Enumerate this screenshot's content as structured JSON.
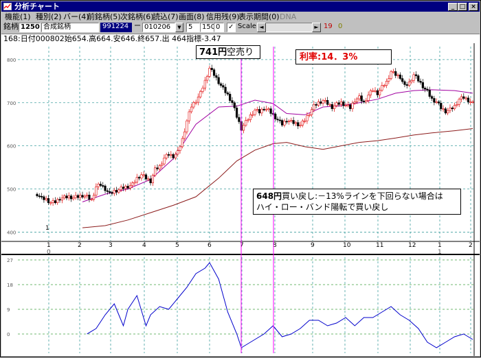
{
  "window": {
    "title": "分析チャート",
    "min_symbol": "_",
    "max_symbol": "□",
    "close_symbol": "×"
  },
  "menu": [
    "機能(1)",
    "種別(2)",
    "バー(4)",
    "前銘柄(5)",
    "次銘柄(6)",
    "読込(7)",
    "画面(8)",
    "信用残(9)",
    "表示期間(0)",
    "DNA"
  ],
  "toolbar": {
    "stock_label": "銘柄",
    "stock_code": "1250",
    "stock_name": "合成銘柄",
    "date_start": "991224",
    "dash": "ー",
    "date_end": "010206",
    "field_a": "5",
    "field_b": "1500",
    "field_c": "0",
    "scale_checked": "✓",
    "scale_label": "Scale",
    "scroll_left": "◄",
    "scroll_right": "►",
    "num_19": "19",
    "num_0": "0"
  },
  "info_line": "168:日付000802始654.高664.安646.終657.出 464指標-3.47",
  "annotations": {
    "sell": {
      "value": "741円",
      "text": "空売り"
    },
    "profit": {
      "label": "利率:",
      "value": "14．3%"
    },
    "buy": {
      "value": "648円",
      "line1": "買い戻し:－13%ラインを下回らない場合は",
      "line2": "ハイ・ロー・バンド陽転で買い戻し"
    }
  },
  "chart_data": {
    "type": "candlestick",
    "price_axis": {
      "ticks": [
        800,
        700,
        600,
        500,
        400
      ],
      "ylim": [
        380,
        830
      ]
    },
    "indicator_axis": {
      "ticks": [
        27,
        18,
        9,
        0
      ],
      "ylim": [
        -7,
        28
      ]
    },
    "x_ticks": [
      "1",
      "2",
      "3",
      "4",
      "5",
      "6",
      "7",
      "8",
      "9",
      "10",
      "11",
      "12",
      "1",
      "2"
    ],
    "year_marks": [
      "0",
      "1"
    ],
    "series": [
      {
        "name": "price",
        "color": "#000000"
      },
      {
        "name": "ma_short",
        "color": "#a000a0"
      },
      {
        "name": "ma_long",
        "color": "#8b1a1a"
      },
      {
        "name": "indicator",
        "color": "#0000cc"
      }
    ],
    "price_path": [
      [
        0,
        488
      ],
      [
        2,
        478
      ],
      [
        4,
        476
      ],
      [
        6,
        468
      ],
      [
        8,
        470
      ],
      [
        10,
        478
      ],
      [
        12,
        480
      ],
      [
        14,
        482
      ],
      [
        16,
        480
      ],
      [
        18,
        482
      ],
      [
        20,
        485
      ],
      [
        22,
        482
      ],
      [
        24,
        474
      ],
      [
        26,
        505
      ],
      [
        28,
        510
      ],
      [
        30,
        500
      ],
      [
        32,
        488
      ],
      [
        34,
        495
      ],
      [
        36,
        498
      ],
      [
        38,
        503
      ],
      [
        40,
        506
      ],
      [
        42,
        510
      ],
      [
        44,
        525
      ],
      [
        46,
        533
      ],
      [
        48,
        525
      ],
      [
        50,
        518
      ],
      [
        52,
        545
      ],
      [
        54,
        552
      ],
      [
        56,
        572
      ],
      [
        58,
        580
      ],
      [
        60,
        576
      ],
      [
        62,
        585
      ],
      [
        64,
        615
      ],
      [
        66,
        658
      ],
      [
        68,
        692
      ],
      [
        70,
        705
      ],
      [
        72,
        722
      ],
      [
        74,
        750
      ],
      [
        76,
        780
      ],
      [
        78,
        765
      ],
      [
        80,
        748
      ],
      [
        82,
        732
      ],
      [
        84,
        718
      ],
      [
        86,
        700
      ],
      [
        88,
        668
      ],
      [
        90,
        640
      ],
      [
        92,
        655
      ],
      [
        94,
        670
      ],
      [
        96,
        683
      ],
      [
        98,
        678
      ],
      [
        100,
        688
      ],
      [
        102,
        682
      ],
      [
        104,
        672
      ],
      [
        106,
        660
      ],
      [
        108,
        650
      ],
      [
        110,
        660
      ],
      [
        112,
        655
      ],
      [
        114,
        652
      ],
      [
        116,
        648
      ],
      [
        118,
        660
      ],
      [
        120,
        676
      ],
      [
        122,
        692
      ],
      [
        124,
        700
      ],
      [
        126,
        705
      ],
      [
        128,
        698
      ],
      [
        130,
        690
      ],
      [
        132,
        696
      ],
      [
        134,
        700
      ],
      [
        136,
        694
      ],
      [
        138,
        688
      ],
      [
        140,
        706
      ],
      [
        142,
        712
      ],
      [
        144,
        700
      ],
      [
        146,
        718
      ],
      [
        148,
        730
      ],
      [
        150,
        722
      ],
      [
        152,
        736
      ],
      [
        154,
        748
      ],
      [
        156,
        772
      ],
      [
        158,
        765
      ],
      [
        160,
        760
      ],
      [
        162,
        738
      ],
      [
        164,
        746
      ],
      [
        166,
        765
      ],
      [
        168,
        752
      ],
      [
        170,
        738
      ],
      [
        172,
        725
      ],
      [
        174,
        708
      ],
      [
        176,
        702
      ],
      [
        178,
        688
      ],
      [
        180,
        680
      ],
      [
        182,
        684
      ],
      [
        184,
        692
      ],
      [
        186,
        708
      ],
      [
        188,
        712
      ],
      [
        190,
        706
      ],
      [
        192,
        698
      ]
    ],
    "ma_short_path": [
      [
        20,
        470
      ],
      [
        30,
        488
      ],
      [
        40,
        500
      ],
      [
        50,
        522
      ],
      [
        60,
        570
      ],
      [
        70,
        650
      ],
      [
        80,
        690
      ],
      [
        88,
        692
      ],
      [
        96,
        706
      ],
      [
        104,
        698
      ],
      [
        110,
        675
      ],
      [
        118,
        672
      ],
      [
        126,
        690
      ],
      [
        134,
        693
      ],
      [
        142,
        700
      ],
      [
        150,
        708
      ],
      [
        158,
        722
      ],
      [
        166,
        728
      ],
      [
        174,
        730
      ],
      [
        184,
        728
      ],
      [
        192,
        722
      ]
    ],
    "ma_long_path": [
      [
        20,
        410
      ],
      [
        30,
        415
      ],
      [
        40,
        428
      ],
      [
        50,
        445
      ],
      [
        60,
        462
      ],
      [
        70,
        482
      ],
      [
        80,
        525
      ],
      [
        88,
        565
      ],
      [
        96,
        590
      ],
      [
        104,
        605
      ],
      [
        110,
        608
      ],
      [
        118,
        598
      ],
      [
        126,
        592
      ],
      [
        134,
        600
      ],
      [
        142,
        608
      ],
      [
        150,
        612
      ],
      [
        158,
        618
      ],
      [
        166,
        625
      ],
      [
        174,
        630
      ],
      [
        184,
        635
      ],
      [
        192,
        640
      ]
    ],
    "indicator_path": [
      [
        22,
        0
      ],
      [
        26,
        2
      ],
      [
        30,
        7
      ],
      [
        34,
        11
      ],
      [
        36,
        7
      ],
      [
        38,
        3
      ],
      [
        40,
        9
      ],
      [
        44,
        14
      ],
      [
        48,
        3
      ],
      [
        50,
        7
      ],
      [
        54,
        10
      ],
      [
        58,
        9
      ],
      [
        62,
        13
      ],
      [
        66,
        17
      ],
      [
        70,
        22
      ],
      [
        74,
        24
      ],
      [
        76,
        26
      ],
      [
        78,
        23
      ],
      [
        80,
        20
      ],
      [
        84,
        8
      ],
      [
        88,
        0
      ],
      [
        90,
        -5
      ],
      [
        92,
        -4
      ],
      [
        96,
        -2
      ],
      [
        100,
        0
      ],
      [
        104,
        3
      ],
      [
        108,
        -1
      ],
      [
        112,
        0
      ],
      [
        116,
        2
      ],
      [
        120,
        5
      ],
      [
        124,
        5
      ],
      [
        128,
        3
      ],
      [
        132,
        4
      ],
      [
        136,
        6
      ],
      [
        140,
        3
      ],
      [
        144,
        6
      ],
      [
        148,
        6
      ],
      [
        152,
        8
      ],
      [
        156,
        10
      ],
      [
        160,
        7
      ],
      [
        164,
        5
      ],
      [
        168,
        2
      ],
      [
        172,
        -3
      ],
      [
        176,
        -5
      ],
      [
        180,
        -3
      ],
      [
        184,
        -1
      ],
      [
        188,
        0
      ],
      [
        192,
        -2
      ]
    ]
  }
}
